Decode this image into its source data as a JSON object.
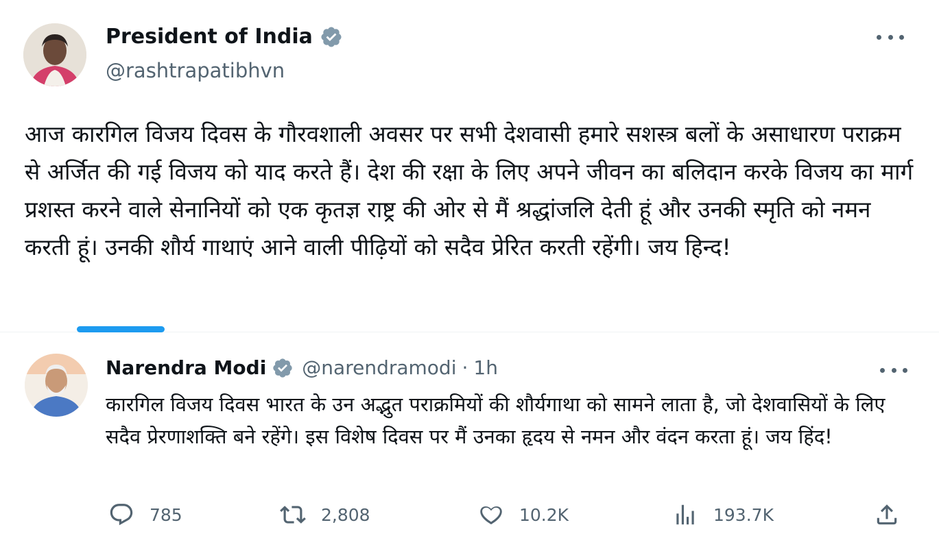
{
  "original_post": {
    "author_name": "President of India",
    "handle": "@rashtrapatibhvn",
    "text": "आज कारगिल विजय दिवस के गौरवशाली अवसर पर सभी देशवासी हमारे सशस्त्र बलों के असाधारण पराक्रम से अर्जित की गई विजय को याद करते हैं। देश की रक्षा के लिए अपने जीवन का बलिदान करके विजय का मार्ग प्रशस्त करने वाले सेनानियों को एक कृतज्ञ राष्ट्र की ओर से मैं श्रद्धांजलि देती हूं और उनकी स्मृति को नमन करती हूं। उनकी शौर्य गाथाएं आने वाली पीढ़ियों को सदैव प्रेरित करती रहेंगी। जय हिन्द!",
    "verified_icon": "verified-badge-icon",
    "badge_color": "#829aab"
  },
  "reply_post": {
    "author_name": "Narendra Modi",
    "handle": "@narendramodi",
    "separator": "·",
    "time": "1h",
    "text": "कारगिल विजय दिवस भारत के उन अद्भुत पराक्रमियों की शौर्यगाथा को सामने लाता है, जो देशवासियों के लिए सदैव प्रेरणाशक्ति बने रहेंगे। इस विशेष दिवस पर मैं उनका हृदय से नमन और वंदन करता हूं। जय हिंद!",
    "verified_icon": "verified-badge-icon"
  },
  "actions": {
    "replies": "785",
    "reposts": "2,808",
    "likes": "10.2K",
    "views": "193.7K"
  },
  "colors": {
    "accent": "#1d9bf0",
    "muted_text": "#536471",
    "main_text": "#0f1419"
  }
}
